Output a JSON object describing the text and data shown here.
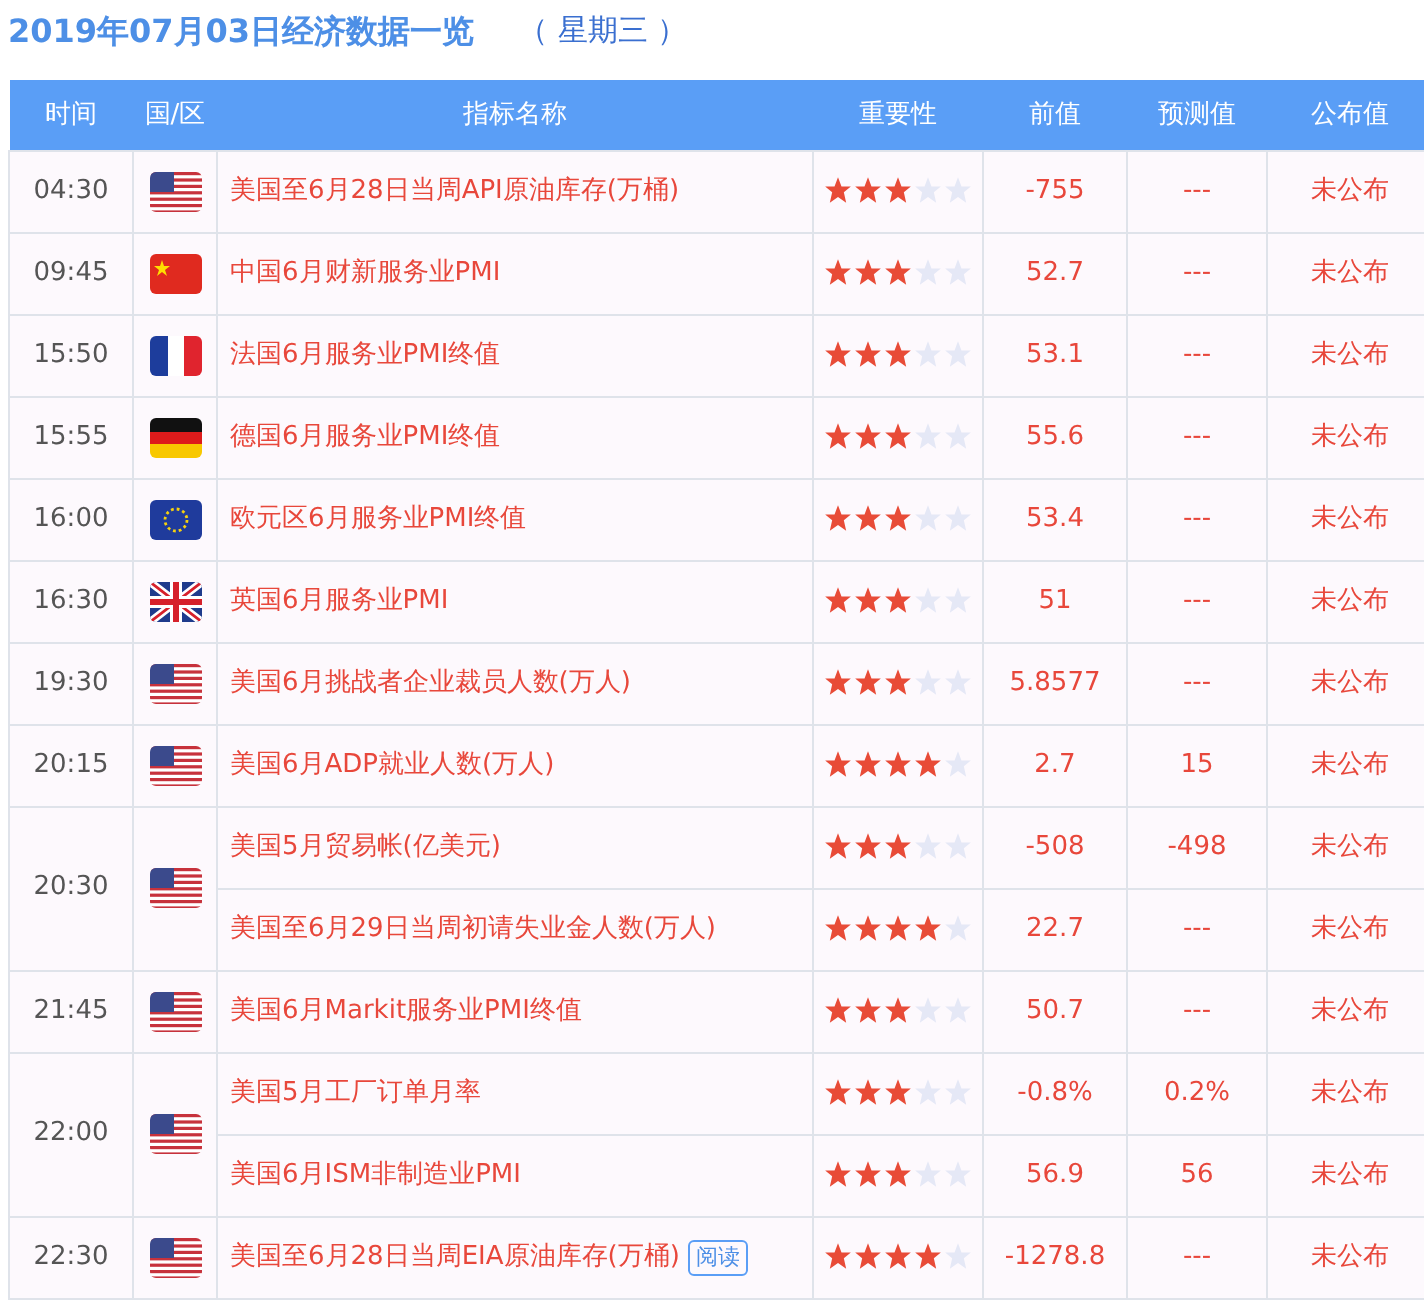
{
  "title": {
    "date": "2019年07月03日经济数据一览",
    "weekday": "（ 星期三 ）"
  },
  "columns": [
    "时间",
    "国/区",
    "指标名称",
    "重要性",
    "前值",
    "预测值",
    "公布值"
  ],
  "groups": [
    {
      "time": "04:30",
      "kind": "us",
      "events": [
        {
          "name": "美国至6月28日当周API原油库存(万桶)",
          "stars": 3,
          "previous": "-755",
          "forecast": "---",
          "actual": "未公布"
        }
      ]
    },
    {
      "time": "09:45",
      "kind": "cn",
      "events": [
        {
          "name": "中国6月财新服务业PMI",
          "stars": 3,
          "previous": "52.7",
          "forecast": "---",
          "actual": "未公布"
        }
      ]
    },
    {
      "time": "15:50",
      "kind": "fr",
      "events": [
        {
          "name": "法国6月服务业PMI终值",
          "stars": 3,
          "previous": "53.1",
          "forecast": "---",
          "actual": "未公布"
        }
      ]
    },
    {
      "time": "15:55",
      "kind": "de",
      "events": [
        {
          "name": "德国6月服务业PMI终值",
          "stars": 3,
          "previous": "55.6",
          "forecast": "---",
          "actual": "未公布"
        }
      ]
    },
    {
      "time": "16:00",
      "kind": "eu",
      "events": [
        {
          "name": "欧元区6月服务业PMI终值",
          "stars": 3,
          "previous": "53.4",
          "forecast": "---",
          "actual": "未公布"
        }
      ]
    },
    {
      "time": "16:30",
      "kind": "gb",
      "events": [
        {
          "name": "英国6月服务业PMI",
          "stars": 3,
          "previous": "51",
          "forecast": "---",
          "actual": "未公布"
        }
      ]
    },
    {
      "time": "19:30",
      "kind": "us",
      "events": [
        {
          "name": "美国6月挑战者企业裁员人数(万人)",
          "stars": 3,
          "previous": "5.8577",
          "forecast": "---",
          "actual": "未公布"
        }
      ]
    },
    {
      "time": "20:15",
      "kind": "us",
      "events": [
        {
          "name": "美国6月ADP就业人数(万人)",
          "stars": 4,
          "previous": "2.7",
          "forecast": "15",
          "actual": "未公布"
        }
      ]
    },
    {
      "time": "20:30",
      "kind": "us",
      "events": [
        {
          "name": "美国5月贸易帐(亿美元)",
          "stars": 3,
          "previous": "-508",
          "forecast": "-498",
          "actual": "未公布"
        },
        {
          "name": "美国至6月29日当周初请失业金人数(万人)",
          "stars": 4,
          "previous": "22.7",
          "forecast": "---",
          "actual": "未公布"
        }
      ]
    },
    {
      "time": "21:45",
      "kind": "us",
      "events": [
        {
          "name": "美国6月Markit服务业PMI终值",
          "stars": 3,
          "previous": "50.7",
          "forecast": "---",
          "actual": "未公布"
        }
      ]
    },
    {
      "time": "22:00",
      "kind": "us",
      "events": [
        {
          "name": "美国5月工厂订单月率",
          "stars": 3,
          "previous": "-0.8%",
          "forecast": "0.2%",
          "actual": "未公布"
        },
        {
          "name": "美国6月ISM非制造业PMI",
          "stars": 3,
          "previous": "56.9",
          "forecast": "56",
          "actual": "未公布"
        }
      ]
    },
    {
      "time": "22:30",
      "kind": "us",
      "events": [
        {
          "name": "美国至6月28日当周EIA原油库存(万桶)",
          "tag": "阅读",
          "stars": 4,
          "previous": "-1278.8",
          "forecast": "---",
          "actual": "未公布"
        }
      ]
    }
  ]
}
